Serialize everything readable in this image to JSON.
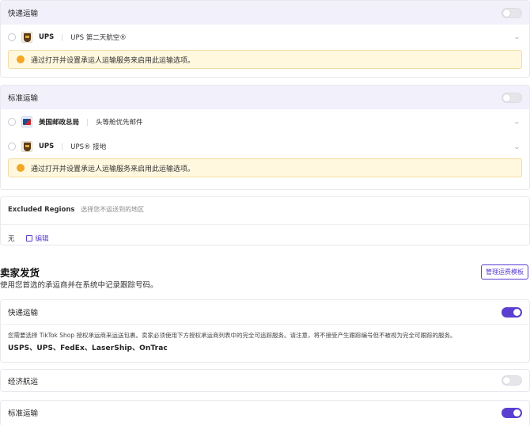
{
  "express": {
    "title": "快递运输",
    "toggle_on": false,
    "carriers": [
      {
        "name": "UPS",
        "service": "UPS 第二天航空®",
        "logo": "ups-logo"
      }
    ],
    "notice": "通过打开并设置承运人运输服务来启用此运输选项。"
  },
  "standard": {
    "title": "标准运输",
    "toggle_on": false,
    "carriers": [
      {
        "name": "美国邮政总局",
        "service": "头等舱优先邮件",
        "logo": "usps-logo"
      },
      {
        "name": "UPS",
        "service": "UPS® 接地",
        "logo": "ups-logo"
      }
    ],
    "notice": "通过打开并设置承运人运输服务来启用此运输选项。"
  },
  "excluded": {
    "label": "Excluded Regions",
    "description": "选择您不运送到的地区",
    "value": "无",
    "edit_label": "编辑"
  },
  "seller": {
    "title": "卖家发货",
    "description": "使用您首选的承运商并在系统中记录跟踪号码。",
    "manage_button": "管理运费模板",
    "express": {
      "title": "快递运输",
      "toggle_on": true,
      "body": "您需要选择 TikTok Shop 授权承运商来运送包裹。卖家必须使用下方授权承运商列表中的完全可追踪服务。请注意，将不接受产生跟踪编号但不被视为完全可跟踪的服务。",
      "carriers": "USPS、UPS、FedEx、LaserShip、OnTrac"
    },
    "economy": {
      "title": "经济航运",
      "toggle_on": false
    },
    "standard": {
      "title": "标准运输",
      "toggle_on": true
    }
  },
  "colors": {
    "accent": "#5b3fd1",
    "notice_bg": "#fff8df",
    "header_bg": "#f1f0fb"
  }
}
